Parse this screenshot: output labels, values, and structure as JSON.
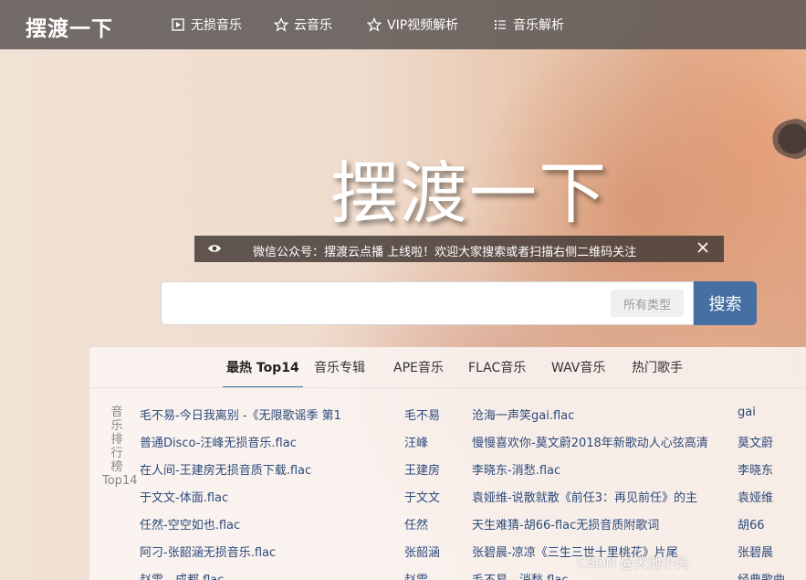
{
  "app": {
    "logo": "摆渡一下"
  },
  "nav": [
    {
      "label": "无损音乐",
      "icon": "play-square-icon"
    },
    {
      "label": "云音乐",
      "icon": "star-icon"
    },
    {
      "label": "VIP视频解析",
      "icon": "star-icon"
    },
    {
      "label": "音乐解析",
      "icon": "list-icon"
    }
  ],
  "hero": {
    "title": "摆渡一下"
  },
  "notice": {
    "text": "微信公众号：摆渡云点播 上线啦！欢迎大家搜索或者扫描右侧二维码关注"
  },
  "search": {
    "placeholder": "",
    "value": "",
    "type_button": "所有类型",
    "button": "搜索"
  },
  "tabs": [
    "最热 Top14",
    "音乐专辑",
    "APE音乐",
    "FLAC音乐",
    "WAV音乐",
    "热门歌手"
  ],
  "active_tab": "最热 Top14",
  "side_label": {
    "lines": [
      "音",
      "乐",
      "排",
      "行",
      "榜"
    ],
    "tail": "Top14"
  },
  "songs_left": [
    {
      "title": "毛不易-今日我离别 -《无限歌谣季 第1",
      "artist": "毛不易"
    },
    {
      "title": "普通Disco-汪峰无损音乐.flac",
      "artist": "汪峰"
    },
    {
      "title": "在人间-王建房无损音质下载.flac",
      "artist": "王建房"
    },
    {
      "title": "于文文-体面.flac",
      "artist": "于文文"
    },
    {
      "title": "任然-空空如也.flac",
      "artist": "任然"
    },
    {
      "title": "阿刁-张韶涵无损音乐.flac",
      "artist": "张韶涵"
    },
    {
      "title": "赵雷 - 成都.flac",
      "artist": "赵雷"
    }
  ],
  "songs_right": [
    {
      "title": "沧海一声笑gai.flac",
      "artist": "gai"
    },
    {
      "title": "慢慢喜欢你-莫文蔚2018年新歌动人心弦高清",
      "artist": "莫文蔚"
    },
    {
      "title": "李晓东-消愁.flac",
      "artist": "李晓东"
    },
    {
      "title": "袁娅维-说散就散《前任3：再见前任》的主",
      "artist": "袁娅维"
    },
    {
      "title": "天生难猜-胡66-flac无损音质附歌词",
      "artist": "胡66"
    },
    {
      "title": "张碧晨-凉凉《三生三世十里桃花》片尾",
      "artist": "张碧晨"
    },
    {
      "title": "毛不易 - 消愁.flac",
      "artist": "经典歌曲"
    }
  ],
  "watermark": "CSDN @天池小天"
}
